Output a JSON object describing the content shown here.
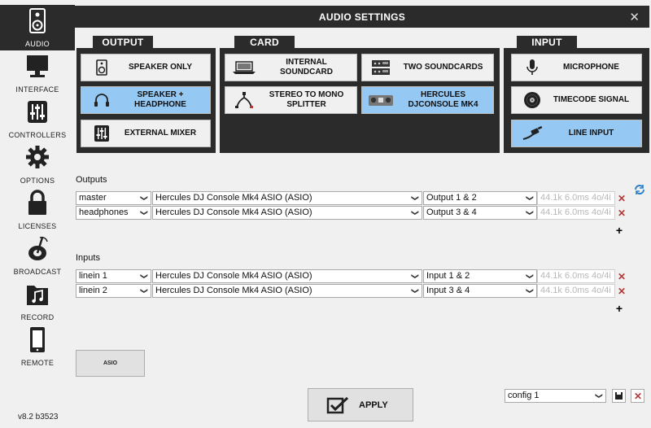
{
  "sidebar": {
    "items": [
      {
        "label": "AUDIO",
        "icon": "speaker-icon",
        "active": true
      },
      {
        "label": "INTERFACE",
        "icon": "monitor-icon"
      },
      {
        "label": "CONTROLLERS",
        "icon": "sliders-icon"
      },
      {
        "label": "OPTIONS",
        "icon": "gear-icon"
      },
      {
        "label": "LICENSES",
        "icon": "lock-icon"
      },
      {
        "label": "BROADCAST",
        "icon": "broadcast-icon"
      },
      {
        "label": "RECORD",
        "icon": "music-folder-icon"
      },
      {
        "label": "REMOTE",
        "icon": "mobile-icon"
      }
    ],
    "version": "v8.2 b3523"
  },
  "window": {
    "title": "AUDIO SETTINGS",
    "close": "✕"
  },
  "groups": {
    "output": {
      "title": "OUTPUT",
      "options": [
        {
          "label": "SPEAKER ONLY",
          "icon": "speaker-icon",
          "selected": false
        },
        {
          "label": "SPEAKER + HEADPHONE",
          "icon": "headphone-icon",
          "selected": true
        },
        {
          "label": "EXTERNAL MIXER",
          "icon": "mixer-icon",
          "selected": false
        }
      ]
    },
    "card": {
      "title": "CARD",
      "options": [
        {
          "label": "INTERNAL SOUNDCARD",
          "icon": "laptop-icon",
          "selected": false
        },
        {
          "label": "TWO SOUNDCARDS",
          "icon": "dual-soundcard-icon",
          "selected": false
        },
        {
          "label": "STEREO TO MONO SPLITTER",
          "icon": "splitter-cable-icon",
          "selected": false
        },
        {
          "label": "HERCULES DJCONSOLE MK4",
          "icon": "controller-icon",
          "selected": true
        }
      ]
    },
    "input": {
      "title": "INPUT",
      "options": [
        {
          "label": "MICROPHONE",
          "icon": "microphone-icon",
          "selected": false
        },
        {
          "label": "TIMECODE SIGNAL",
          "icon": "vinyl-icon",
          "selected": false
        },
        {
          "label": "LINE INPUT",
          "icon": "rca-cable-icon",
          "selected": true
        }
      ]
    }
  },
  "outputs": {
    "label": "Outputs",
    "rows": [
      {
        "channel": "master",
        "device": "Hercules DJ Console Mk4 ASIO (ASIO)",
        "port": "Output 1 & 2",
        "info": "44.1k 6.0ms 4o/4i"
      },
      {
        "channel": "headphones",
        "device": "Hercules DJ Console Mk4 ASIO (ASIO)",
        "port": "Output 3 & 4",
        "info": "44.1k 6.0ms 4o/4i"
      }
    ]
  },
  "inputs": {
    "label": "Inputs",
    "rows": [
      {
        "channel": "linein 1",
        "device": "Hercules DJ Console Mk4 ASIO (ASIO)",
        "port": "Input 1 & 2",
        "info": "44.1k 6.0ms 4o/4i"
      },
      {
        "channel": "linein 2",
        "device": "Hercules DJ Console Mk4 ASIO (ASIO)",
        "port": "Input 3 & 4",
        "info": "44.1k 6.0ms 4o/4i"
      }
    ]
  },
  "buttons": {
    "asio": "ASIO",
    "apply": "APPLY"
  },
  "config": {
    "value": "config 1"
  },
  "colors": {
    "dark": "#2b2b2b",
    "selected": "#95c8f3",
    "delete": "#b23a3a"
  }
}
